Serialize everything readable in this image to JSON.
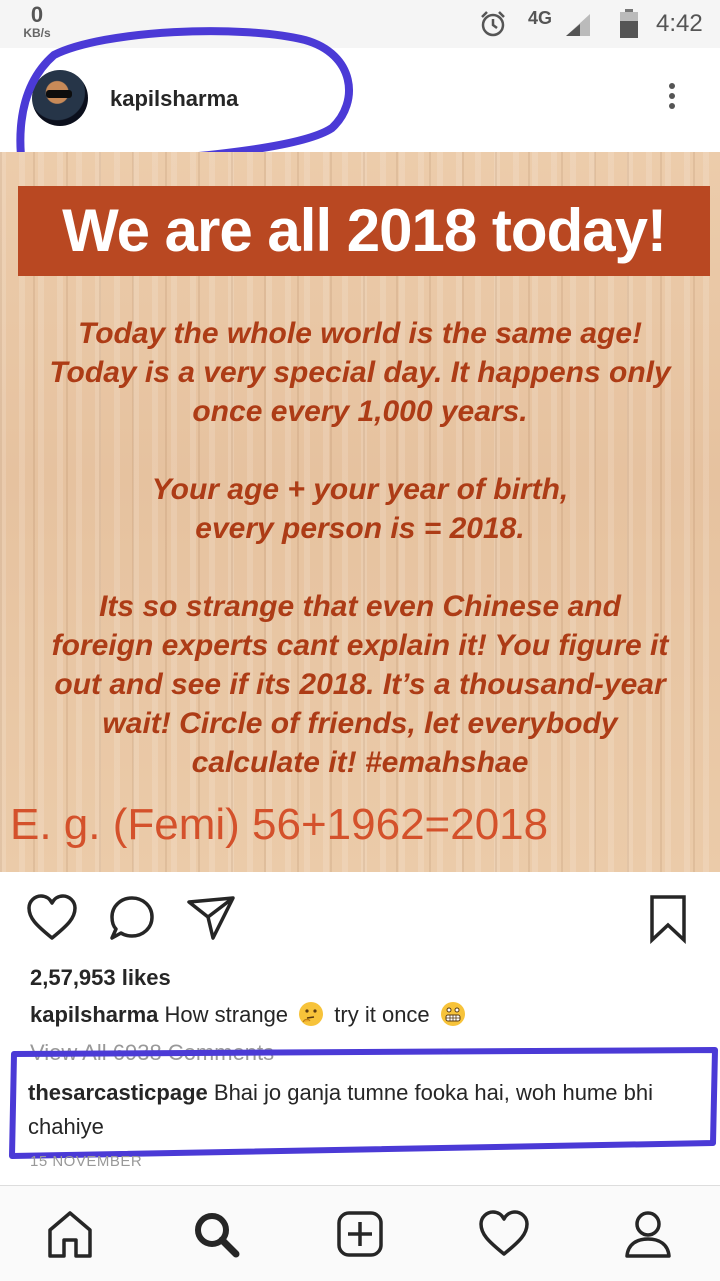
{
  "status_bar": {
    "speed_value": "0",
    "speed_unit": "KB/s",
    "network": "4G",
    "time": "4:42",
    "icons": [
      "alarm-icon",
      "signal-icon",
      "battery-icon"
    ]
  },
  "post": {
    "username": "kapilsharma",
    "more_icon": "more-vertical-icon",
    "image": {
      "banner": "We are all 2018 today!",
      "paragraphs": [
        "Today the whole world is the same age!\nToday is a very special day. It happens only\nonce every 1,000 years.",
        "Your age + your year of birth,\nevery person is = 2018.",
        "Its so strange that even Chinese and\nforeign experts cant explain it! You figure it\nout and see if its 2018.  It’s a thousand-year\nwait!  Circle of friends, let everybody\ncalculate it!   #emahshae"
      ],
      "example": "E. g. (Femi) 56+1962=2018"
    },
    "actions": [
      "heart-icon",
      "comment-icon",
      "share-icon",
      "bookmark-icon"
    ],
    "likes": "2,57,953 likes",
    "caption": {
      "username": "kapilsharma",
      "text_before": "How strange",
      "text_after": "try it once"
    },
    "view_all": "View All 6938 Comments",
    "comment": {
      "username": "thesarcasticpage",
      "text": "Bhai jo ganja tumne fooka hai, woh hume bhi chahiye"
    },
    "date": "15 NOVEMBER"
  },
  "annotation_color": "#4b3ad6",
  "bottom_nav": [
    "home-icon",
    "search-icon",
    "add-post-icon",
    "activity-icon",
    "profile-icon"
  ]
}
